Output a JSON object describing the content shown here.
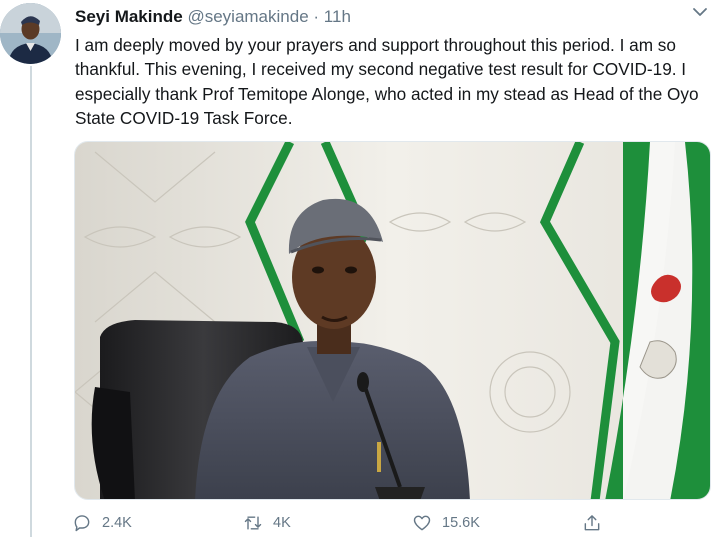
{
  "tweet": {
    "author_name": "Seyi Makinde",
    "handle": "@seyiamakinde",
    "separator": "·",
    "time": "11h",
    "text": "I am deeply moved by your prayers and support throughout this period. I am so thankful. This evening, I received my second negative test result for COVID-19. I especially thank Prof Temitope Alonge, who acted in my stead as Head of the Oyo State COVID-19 Task Force."
  },
  "actions": {
    "reply_count": "2.4K",
    "retweet_count": "4K",
    "like_count": "15.6K"
  },
  "icons": {
    "reply": "reply-icon",
    "retweet": "retweet-icon",
    "like": "heart-icon",
    "share": "share-icon",
    "menu": "chevron-down-icon"
  },
  "colors": {
    "text_primary": "#14171a",
    "text_secondary": "#657786",
    "flag_green": "#1e8f3b"
  }
}
